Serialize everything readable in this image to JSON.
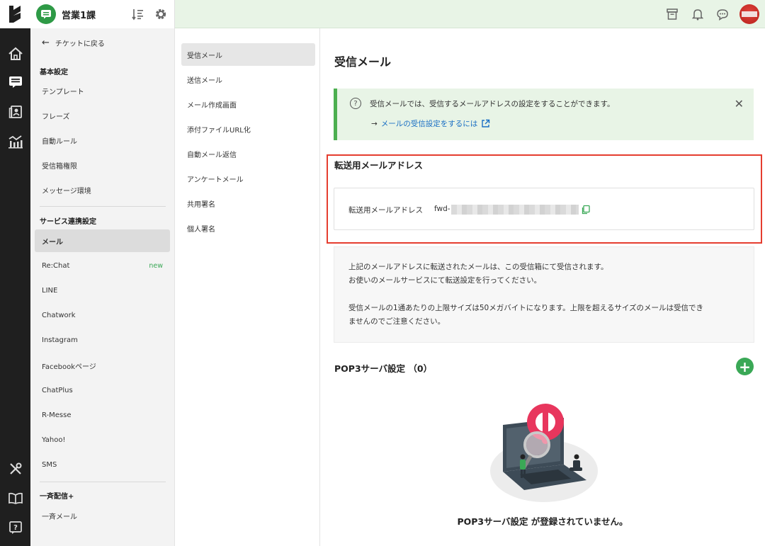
{
  "header": {
    "group_name": "営業1課",
    "icons": [
      "logo-icon",
      "group-chat-icon",
      "sort-icon",
      "settings-gear-icon",
      "archive-icon",
      "bell-icon",
      "support-chat-icon",
      "user-avatar"
    ]
  },
  "rail": {
    "icons": [
      "home-icon",
      "ticket-icon",
      "contacts-icon",
      "analytics-icon",
      "tools-icon",
      "book-icon",
      "help-icon"
    ]
  },
  "sidebar": {
    "back_label": "チケットに戻る",
    "section_basic": "基本設定",
    "basic_items": [
      "テンプレート",
      "フレーズ",
      "自動ルール",
      "受信箱権限",
      "メッセージ環境"
    ],
    "section_service": "サービス連携設定",
    "service_items": [
      "メール",
      "Re:Chat",
      "LINE",
      "Chatwork",
      "Instagram",
      "Facebookページ",
      "ChatPlus",
      "R-Messe",
      "Yahoo!",
      "SMS"
    ],
    "new_badge": "new",
    "section_bulk": "一斉配信+",
    "bulk_items": [
      "一斉メール"
    ]
  },
  "submenu": {
    "items": [
      "受信メール",
      "送信メール",
      "メール作成画面",
      "添付ファイルURL化",
      "自動メール返信",
      "アンケートメール",
      "共用署名",
      "個人署名"
    ]
  },
  "main": {
    "title": "受信メール",
    "info_message": "受信メールでは、受信するメールアドレスの設定をすることができます。",
    "info_link": "メールの受信設定をするには",
    "forward_section_title": "転送用メールアドレス",
    "forward_label": "転送用メールアドレス",
    "forward_value_prefix": "fwd-",
    "desc_line1": "上記のメールアドレスに転送されたメールは、この受信箱にて受信されます。",
    "desc_line2": "お使いのメールサービスにて転送設定を行ってください。",
    "desc_line3": "受信メールの1通あたりの上限サイズは50メガバイトになります。上限を超えるサイズのメールは受信でき",
    "desc_line4": "ませんのでご注意ください。",
    "pop3_title": "POP3サーバ設定 （0）",
    "pop3_empty": "POP3サーバ設定 が登録されていません。"
  },
  "colors": {
    "accent_green": "#3aa856",
    "header_bg": "#e8f4e6",
    "highlight_red": "#e53d2f",
    "link_blue": "#1a6fc4"
  }
}
